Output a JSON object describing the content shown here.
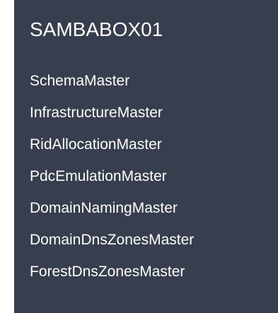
{
  "server": {
    "name": "SAMBABOX01",
    "roles": [
      "SchemaMaster",
      "InfrastructureMaster",
      "RidAllocationMaster",
      "PdcEmulationMaster",
      "DomainNamingMaster",
      "DomainDnsZonesMaster",
      "ForestDnsZonesMaster"
    ]
  },
  "colors": {
    "panel_background": "#373e4d",
    "text": "#ffffff"
  }
}
